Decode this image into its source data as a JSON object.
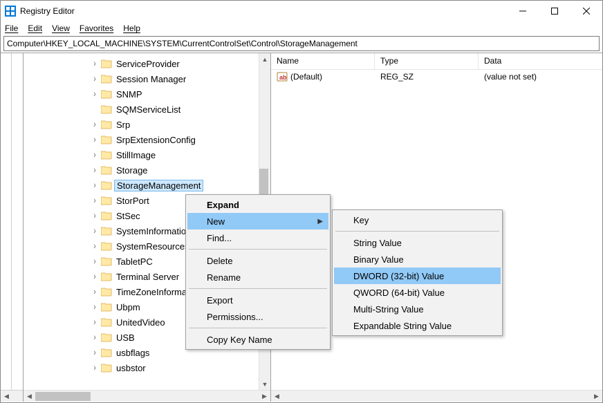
{
  "window": {
    "title": "Registry Editor"
  },
  "menubar": {
    "file": "File",
    "edit": "Edit",
    "view": "View",
    "favorites": "Favorites",
    "help": "Help"
  },
  "address": "Computer\\HKEY_LOCAL_MACHINE\\SYSTEM\\CurrentControlSet\\Control\\StorageManagement",
  "tree": {
    "items": [
      {
        "label": "ServiceProvider",
        "expandable": true
      },
      {
        "label": "Session Manager",
        "expandable": true
      },
      {
        "label": "SNMP",
        "expandable": true
      },
      {
        "label": "SQMServiceList",
        "expandable": false
      },
      {
        "label": "Srp",
        "expandable": true
      },
      {
        "label": "SrpExtensionConfig",
        "expandable": true
      },
      {
        "label": "StillImage",
        "expandable": true
      },
      {
        "label": "Storage",
        "expandable": true
      },
      {
        "label": "StorageManagement",
        "expandable": true,
        "selected": true
      },
      {
        "label": "StorPort",
        "expandable": true
      },
      {
        "label": "StSec",
        "expandable": true
      },
      {
        "label": "SystemInformation",
        "expandable": true
      },
      {
        "label": "SystemResources",
        "expandable": true
      },
      {
        "label": "TabletPC",
        "expandable": true
      },
      {
        "label": "Terminal Server",
        "expandable": true
      },
      {
        "label": "TimeZoneInformation",
        "expandable": true
      },
      {
        "label": "Ubpm",
        "expandable": true
      },
      {
        "label": "UnitedVideo",
        "expandable": true
      },
      {
        "label": "USB",
        "expandable": true
      },
      {
        "label": "usbflags",
        "expandable": true
      },
      {
        "label": "usbstor",
        "expandable": true
      }
    ]
  },
  "list": {
    "headers": {
      "name": "Name",
      "type": "Type",
      "data": "Data"
    },
    "rows": [
      {
        "name": "(Default)",
        "type": "REG_SZ",
        "data": "(value not set)"
      }
    ]
  },
  "context_menu": {
    "expand": "Expand",
    "new": "New",
    "find": "Find...",
    "delete": "Delete",
    "rename": "Rename",
    "export": "Export",
    "permissions": "Permissions...",
    "copy_key_name": "Copy Key Name"
  },
  "new_submenu": {
    "key": "Key",
    "string": "String Value",
    "binary": "Binary Value",
    "dword": "DWORD (32-bit) Value",
    "qword": "QWORD (64-bit) Value",
    "multi": "Multi-String Value",
    "expandable": "Expandable String Value"
  }
}
